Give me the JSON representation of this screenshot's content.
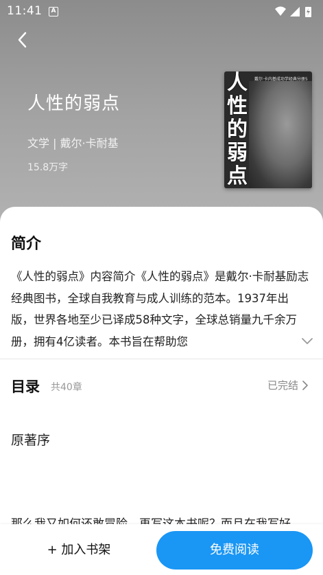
{
  "status_bar": {
    "time": "11:41",
    "notification_badge": "A",
    "icons": [
      "wifi-icon",
      "signal-icon",
      "battery-charging-icon"
    ]
  },
  "book": {
    "title": "人性的弱点",
    "meta": "文学 | 戴尔·卡耐基",
    "word_count": "15.8万字",
    "cover": {
      "title_chars": [
        "人",
        "性",
        "的",
        "弱",
        "点"
      ],
      "tagline": "戴尔·卡内基成功学经典分册5"
    }
  },
  "intro": {
    "heading": "简介",
    "text": "《人性的弱点》内容简介《人性的弱点》是戴尔·卡耐基励志经典图书，全球自我教育与成人训练的范本。1937年出版，世界各地至少已译成58种文字，全球总销量九千余万册，拥有4亿读者。本书旨在帮助您"
  },
  "toc": {
    "heading": "目录",
    "count": "共40章",
    "status": "已完结",
    "chapters": [
      "原著序"
    ],
    "preview": "那么我又如何还敢冒险，再写这本书呢？而且在我写好"
  },
  "actions": {
    "add_shelf": "+ 加入书架",
    "read_free": "免费阅读"
  },
  "colors": {
    "accent": "#1a96f5",
    "hero_bg": "#9a9a9a"
  }
}
